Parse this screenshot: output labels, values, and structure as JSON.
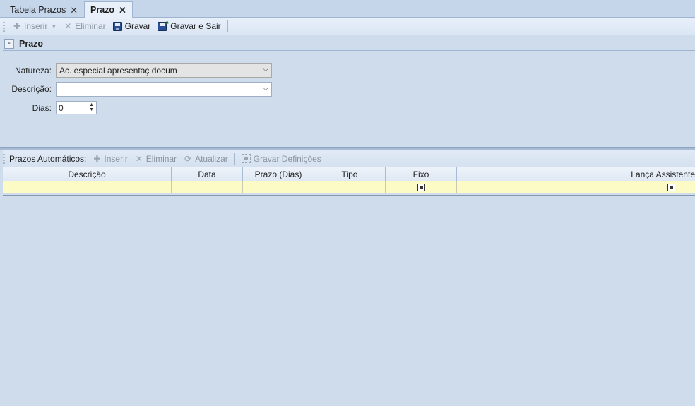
{
  "tabs": [
    {
      "label": "Tabela Prazos",
      "active": false
    },
    {
      "label": "Prazo",
      "active": true
    }
  ],
  "toolbar": {
    "insert_label": "Inserir",
    "delete_label": "Eliminar",
    "save_label": "Gravar",
    "save_exit_label": "Gravar e Sair"
  },
  "group": {
    "collapse_label": "-",
    "title": "Prazo"
  },
  "form": {
    "natureza_label": "Natureza:",
    "natureza_value": "Ac. especial apresentaç docum",
    "descricao_label": "Descrição:",
    "descricao_value": "",
    "dias_label": "Dias:",
    "dias_value": "0"
  },
  "auto": {
    "label": "Prazos Automáticos:",
    "insert_label": "Inserir",
    "delete_label": "Eliminar",
    "refresh_label": "Atualizar",
    "save_defs_label": "Gravar Definições"
  },
  "grid": {
    "columns": [
      "Descrição",
      "Data",
      "Prazo (Dias)",
      "Tipo",
      "Fixo",
      "Lança Assistente"
    ],
    "rows": [
      {
        "descricao": "",
        "data": "",
        "prazo": "",
        "tipo": "",
        "fixo": true,
        "lanca": true
      }
    ]
  },
  "colors": {
    "background": "#cfdcec",
    "new_row": "#fcfbc6",
    "toolbar": "#dbe6f4"
  }
}
